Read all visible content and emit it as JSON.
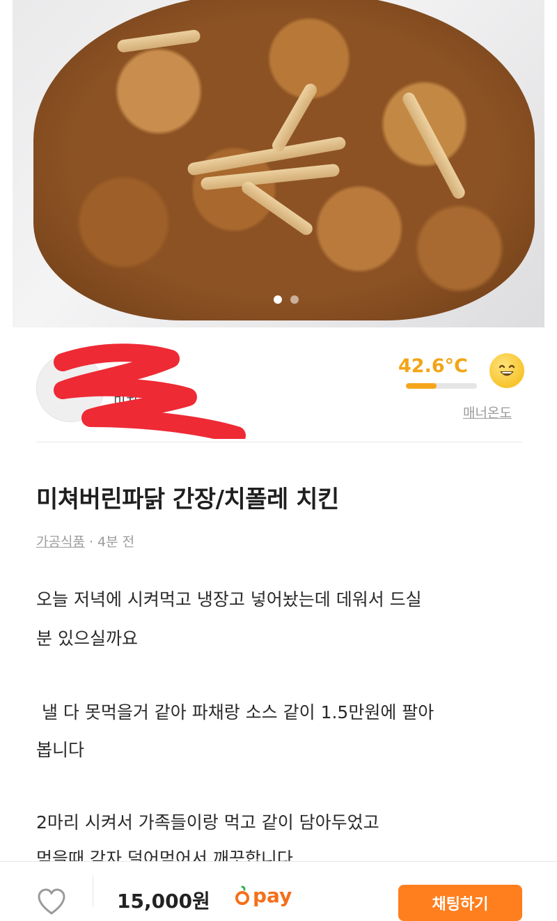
{
  "photo": {
    "alt": "chicken photo",
    "page_count": 2,
    "active_page": 1
  },
  "seller": {
    "nickname": "미치",
    "manner_temp": "42.6°C",
    "manner_temp_level": 0.43,
    "manner_label": "매너온도"
  },
  "post": {
    "title": "미쳐버린파닭 간장/치폴레 치킨",
    "category": "가공식품",
    "separator": " · ",
    "time": "4분 전",
    "paragraphs": [
      "오늘 저녁에 시켜먹고 냉장고 넣어놨는데 데워서 드실",
      "분 있으실까요",
      " 낼 다 못먹을거 같아 파채랑 소스 같이 1.5만원에 팔아",
      "봅니다",
      "2마리 시켜서 가족들이랑 먹고 같이 담아두었고",
      "먹을때 각자 덜어먹어서 깨끗합니다"
    ]
  },
  "bottom_bar": {
    "price": "15,000원",
    "pay_label": "pay",
    "chat_button": "채팅하기"
  },
  "colors": {
    "accent": "#ff7e1d",
    "temp": "#f2a516",
    "pay": "#f56f1a"
  }
}
